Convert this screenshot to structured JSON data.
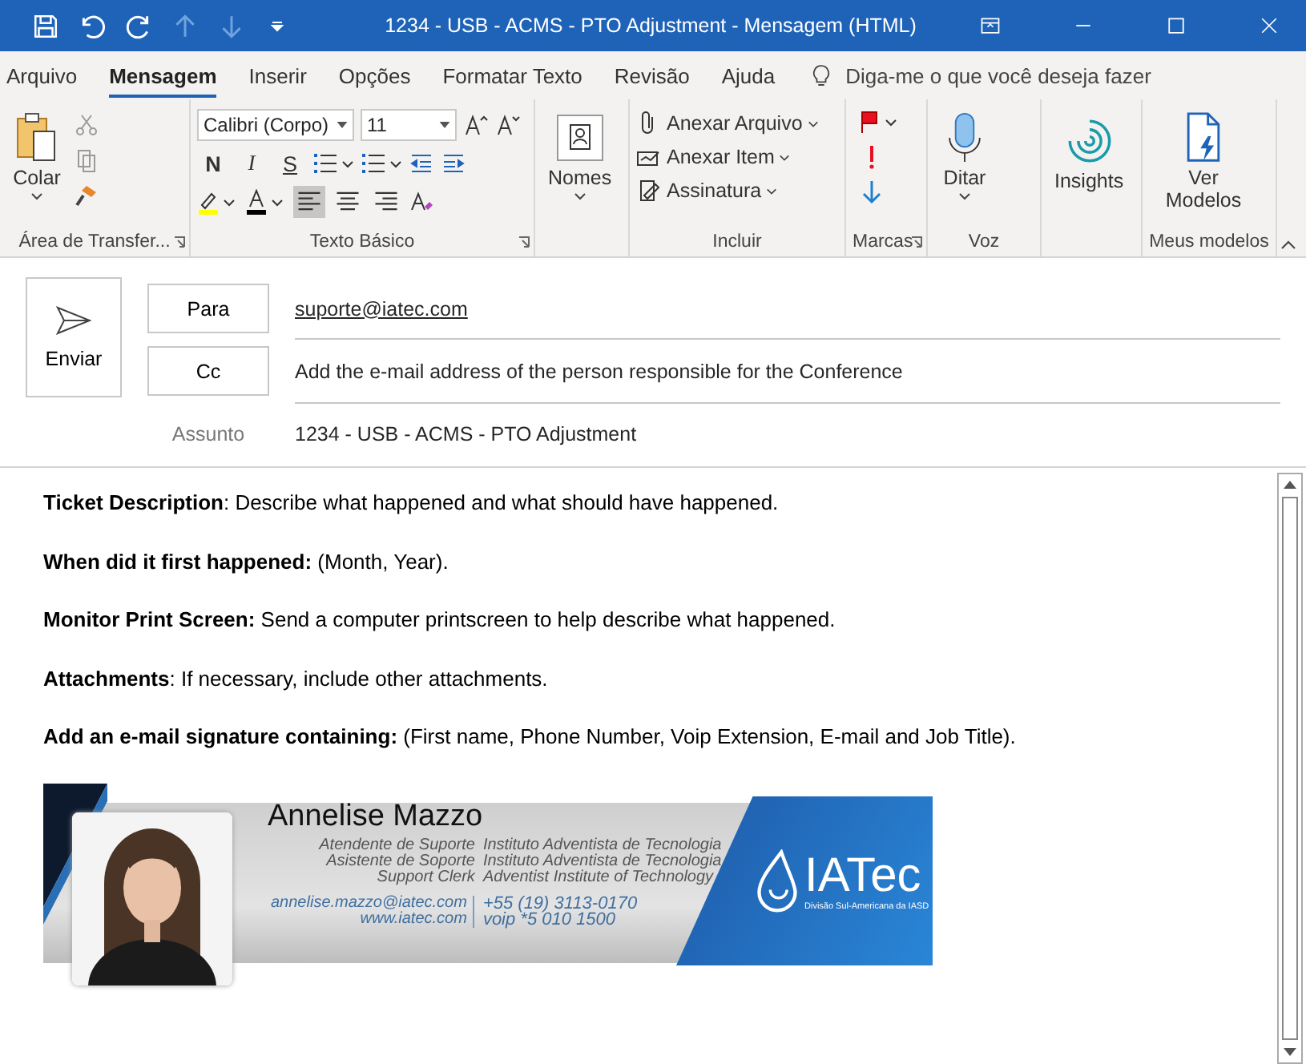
{
  "title_bar": {
    "title": "1234 - USB - ACMS - PTO Adjustment  -  Mensagem (HTML)"
  },
  "menu_tabs": [
    {
      "label": "Arquivo",
      "selected": false
    },
    {
      "label": "Mensagem",
      "selected": true
    },
    {
      "label": "Inserir",
      "selected": false
    },
    {
      "label": "Opções",
      "selected": false
    },
    {
      "label": "Formatar Texto",
      "selected": false
    },
    {
      "label": "Revisão",
      "selected": false
    },
    {
      "label": "Ajuda",
      "selected": false
    }
  ],
  "tell_me": {
    "placeholder": "Diga-me o que você deseja fazer"
  },
  "ribbon": [
    {
      "kind": "clipboard",
      "label": "Área de Transfer...",
      "button": "Colar"
    },
    {
      "kind": "font",
      "label": "Texto Básico",
      "font_name": "Calibri (Corpo)",
      "font_size": "11",
      "bold": "N",
      "italic": "I",
      "strike": "S",
      "alignments": [
        {
          "selected": true
        },
        {
          "selected": false
        },
        {
          "selected": false
        }
      ]
    },
    {
      "kind": "names",
      "button": "Nomes"
    },
    {
      "kind": "include",
      "label": "Incluir",
      "items": [
        "Anexar Arquivo",
        "Anexar Item",
        "Assinatura"
      ]
    },
    {
      "kind": "tags",
      "label": "Marcas"
    },
    {
      "kind": "voice",
      "label": "Voz",
      "button": "Ditar"
    },
    {
      "kind": "insights",
      "button": "Insights"
    },
    {
      "kind": "templates",
      "label": "Meus modelos",
      "button": "Ver Modelos"
    }
  ],
  "header": {
    "send": "Enviar",
    "to_button": "Para",
    "to": "suporte@iatec.com",
    "cc_button": "Cc",
    "cc": "Add the e-mail address of the person responsible for the Conference",
    "subject_label": "Assunto",
    "subject": "1234 - USB - ACMS - PTO Adjustment"
  },
  "body": [
    "**Ticket Description**: Describe what happened and what should have happened.",
    "**When did it first happened:** (Month, Year).",
    "**Monitor Print Screen:** Send a computer printscreen to help describe what happened.",
    "**Attachments**: If necessary, include other attachments.",
    "**Add an e-mail signature containing:** (First name, Phone Number, Voip Extension, E-mail and Job Title)."
  ],
  "signature": {
    "name": "Annelise Mazzo",
    "roles": [
      "Atendente de Suporte",
      "Asistente de Soporte",
      "Support Clerk"
    ],
    "institutes": [
      "Instituto Adventista de Tecnologia",
      "Instituto Adventista de Tecnologia",
      "Adventist Institute of Technology"
    ],
    "web": [
      "annelise.mazzo@iatec.com",
      "www.iatec.com"
    ],
    "phones": [
      "+55 (19) 3113-0170",
      "voip *5 010 1500"
    ],
    "logo": "IATec",
    "logo_caption": "Divisão Sul-Americana da IASD"
  }
}
